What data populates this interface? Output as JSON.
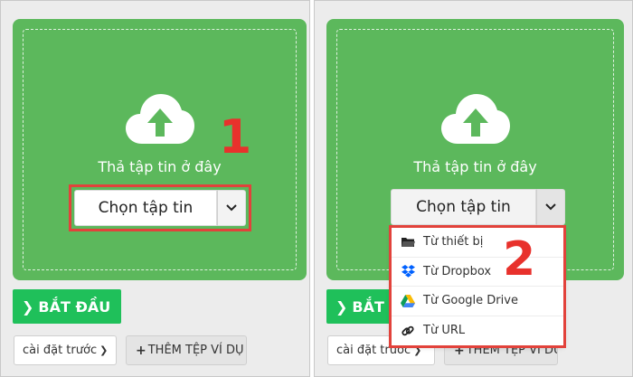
{
  "steps": {
    "first": "1",
    "second": "2"
  },
  "dropzone": {
    "drop_text": "Thả tập tin ở đây",
    "color": "#5cb85c"
  },
  "choose_button": {
    "label": "Chọn tập tin"
  },
  "start_button": {
    "label": "BẮT ĐẦU",
    "color": "#1fc05a"
  },
  "preset": {
    "label": "cài đặt trước"
  },
  "sample_button": {
    "label": "THÊM TỆP VÍ DỤ"
  },
  "source_menu": {
    "items": [
      {
        "label": "Từ thiết bị",
        "icon": "folder-icon"
      },
      {
        "label": "Từ Dropbox",
        "icon": "dropbox-icon"
      },
      {
        "label": "Từ Google Drive",
        "icon": "google-drive-icon"
      },
      {
        "label": "Từ URL",
        "icon": "link-icon"
      }
    ]
  },
  "highlight_color": "#e2423b"
}
